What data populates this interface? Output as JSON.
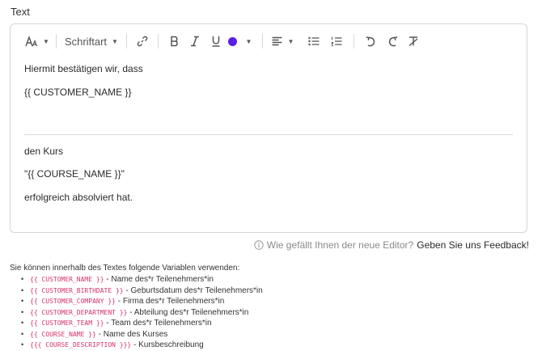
{
  "field_label": "Text",
  "toolbar": {
    "font_size_icon": "font-size-icon",
    "font_family_label": "Schriftart",
    "color": "#5b1ee8"
  },
  "content": {
    "line1": "Hiermit bestätigen wir, dass",
    "line2": "{{ CUSTOMER_NAME }}",
    "line3": "den Kurs",
    "line4": "\"{{ COURSE_NAME }}\"",
    "line5": "erfolgreich absolviert hat."
  },
  "feedback": {
    "question": "Wie gefällt Ihnen der neue Editor?",
    "link": "Geben Sie uns Feedback!"
  },
  "variables": {
    "intro": "Sie können innerhalb des Textes folgende Variablen verwenden:",
    "items": [
      {
        "code": "{{ CUSTOMER_NAME }}",
        "desc": " - Name des*r Teilenehmers*in"
      },
      {
        "code": "{{ CUSTOMER_BIRTHDATE }}",
        "desc": " - Geburtsdatum des*r Teilenehmers*in"
      },
      {
        "code": "{{ CUSTOMER_COMPANY }}",
        "desc": " - Firma des*r Teilenehmers*in"
      },
      {
        "code": "{{ CUSTOMER_DEPARTMENT }}",
        "desc": " - Abteilung des*r Teilenehmers*in"
      },
      {
        "code": "{{ CUSTOMER_TEAM }}",
        "desc": " - Team des*r Teilenehmers*in"
      },
      {
        "code": "{{ COURSE_NAME }}",
        "desc": " - Name des Kurses"
      },
      {
        "code": "{{{ COURSE_DESCRIPTION }}}",
        "desc": " - Kursbeschreibung"
      }
    ]
  }
}
